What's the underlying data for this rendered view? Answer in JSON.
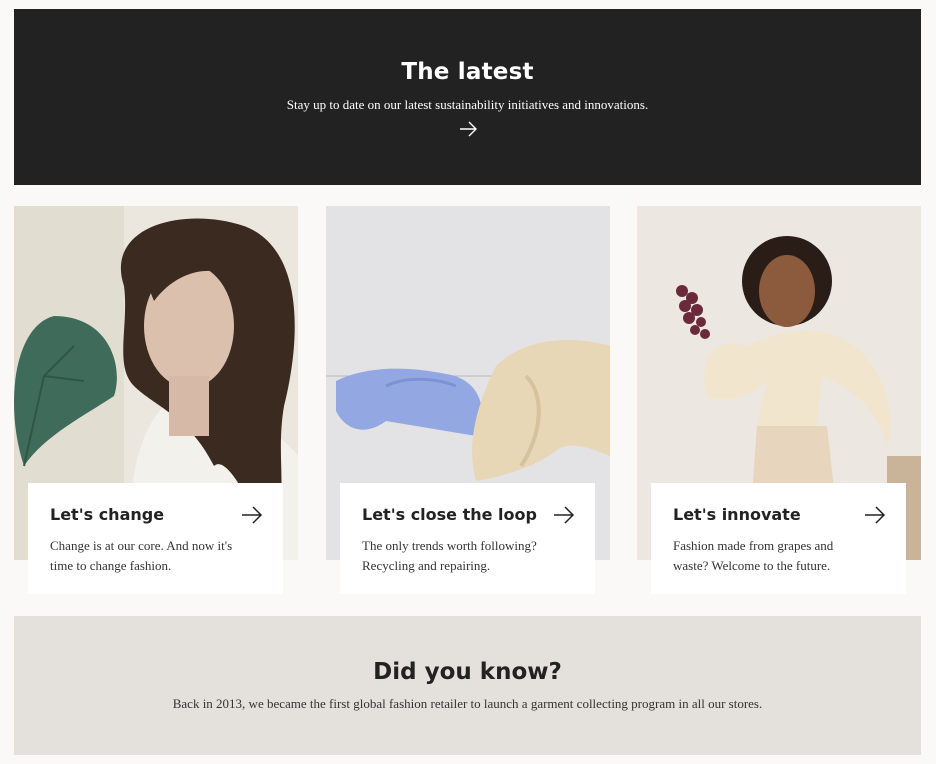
{
  "hero": {
    "title": "The latest",
    "subtitle": "Stay up to date on our latest sustainability initiatives and innovations."
  },
  "cards": [
    {
      "title": "Let's change",
      "text": "Change is at our core. And now it's time to change fashion.",
      "image": "woman-with-monstera-leaf"
    },
    {
      "title": "Let's close the loop",
      "text": "The only trends worth following? Recycling and repairing.",
      "image": "clothes-on-line"
    },
    {
      "title": "Let's innovate",
      "text": "Fashion made from grapes and waste? Welcome to the future.",
      "image": "woman-holding-grapes"
    }
  ],
  "did_you_know": {
    "title": "Did you know?",
    "text": "Back in 2013, we became the first global fashion retailer to launch a garment collecting program in all our stores."
  },
  "colors": {
    "hero_bg": "#222222",
    "page_bg": "#faf9f8",
    "know_bg": "#e4e0dc"
  }
}
